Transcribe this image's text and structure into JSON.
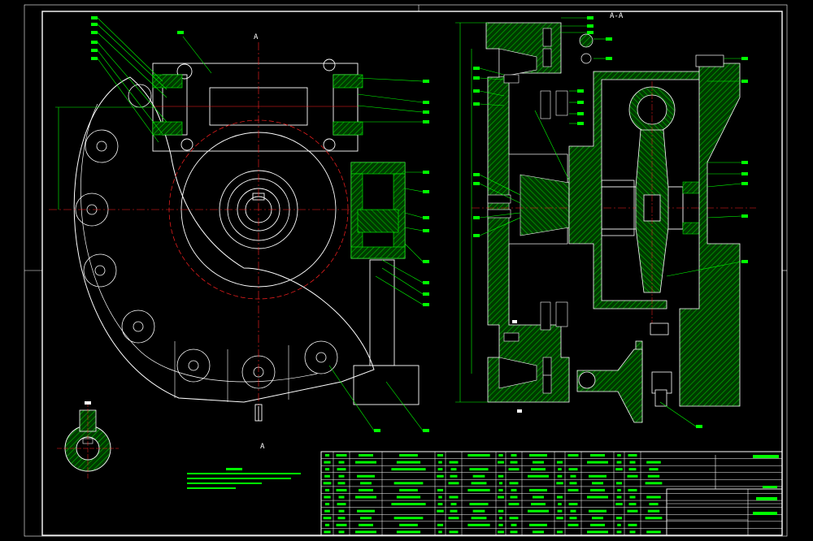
{
  "view_labels": {
    "section_top": "A",
    "section_bottom": "A",
    "section_title": "A-A"
  },
  "colors": {
    "background": "#000000",
    "outline": "#ffffff",
    "hatch": "#00c800",
    "centerline": "#ff2020",
    "leader": "#00ff00",
    "frame": "#ffffff"
  }
}
